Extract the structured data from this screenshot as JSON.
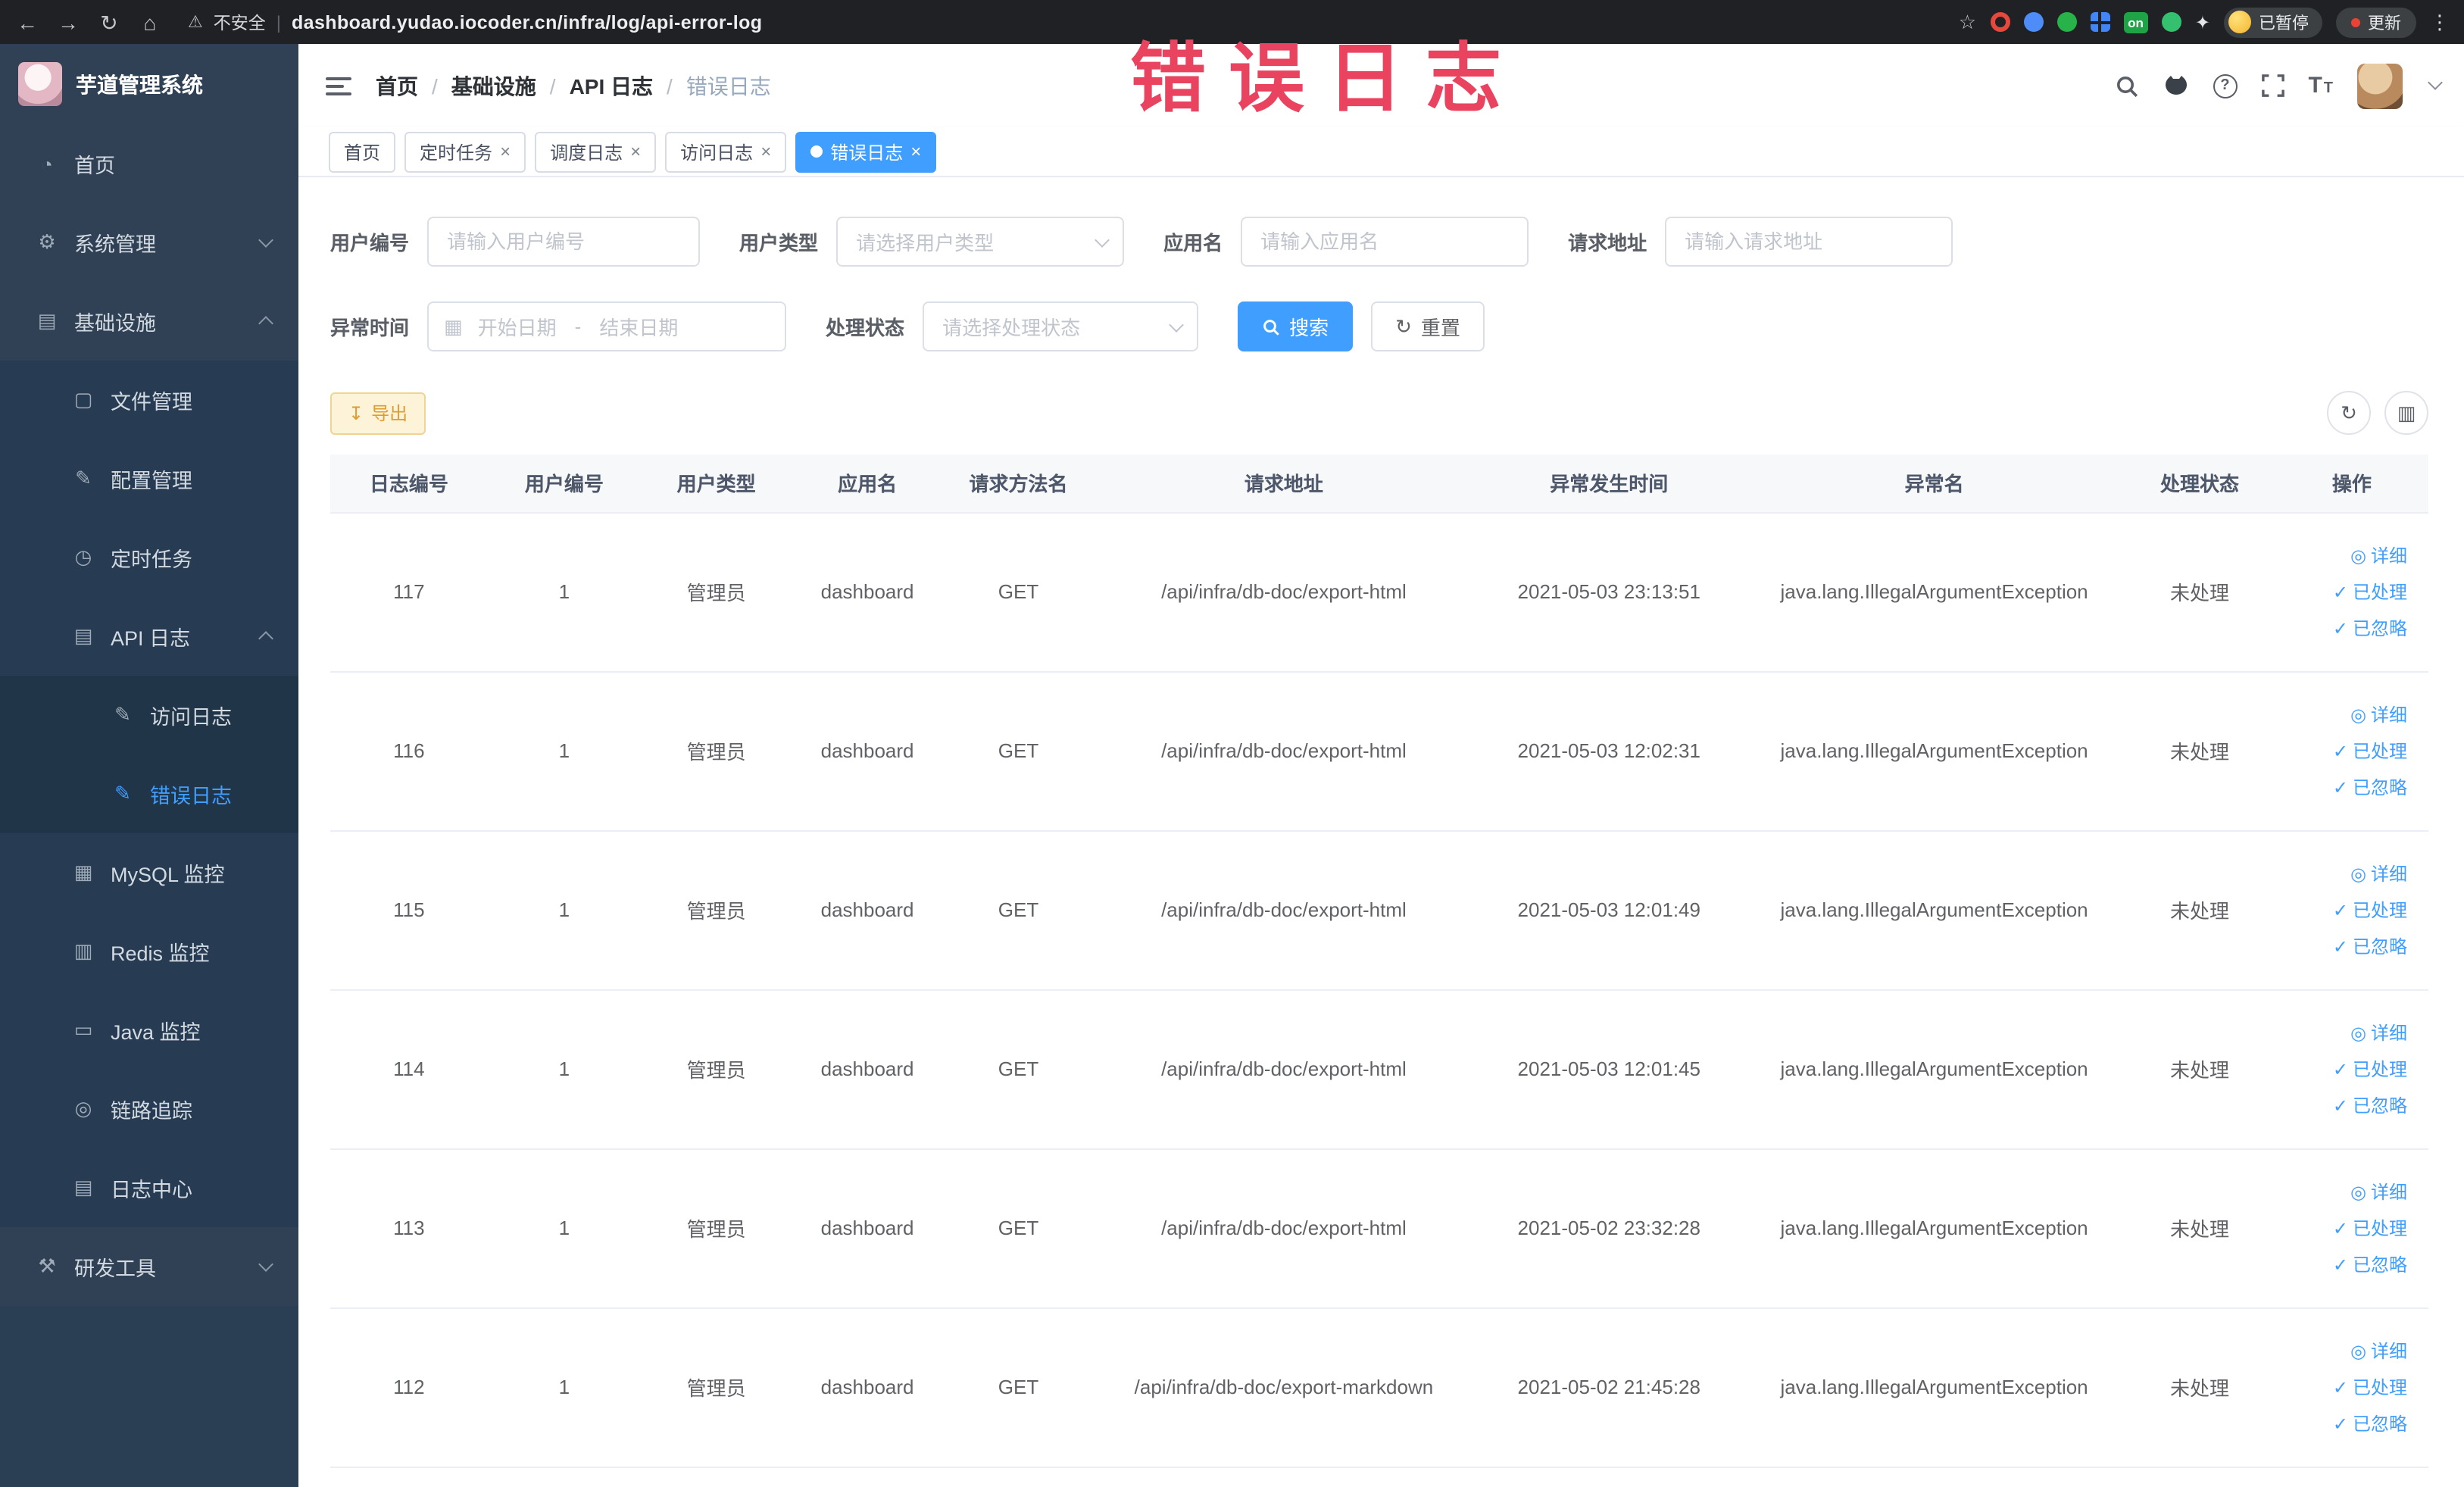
{
  "browser": {
    "security_label": "不安全",
    "url": "dashboard.yudao.iocoder.cn/infra/log/api-error-log",
    "paused_badge": "已暂停",
    "update_button": "更新",
    "ext_on_label": "on"
  },
  "annotation": {
    "text": "错误日志",
    "color": "#e94360"
  },
  "sidebar": {
    "logo_title": "芋道管理系统",
    "items": [
      {
        "label": "首页"
      },
      {
        "label": "系统管理"
      },
      {
        "label": "基础设施"
      },
      {
        "label": "文件管理"
      },
      {
        "label": "配置管理"
      },
      {
        "label": "定时任务"
      },
      {
        "label": "API 日志"
      },
      {
        "label": "访问日志"
      },
      {
        "label": "错误日志"
      },
      {
        "label": "MySQL 监控"
      },
      {
        "label": "Redis 监控"
      },
      {
        "label": "Java 监控"
      },
      {
        "label": "链路追踪"
      },
      {
        "label": "日志中心"
      },
      {
        "label": "研发工具"
      }
    ]
  },
  "breadcrumb": {
    "separator": "/",
    "items": [
      "首页",
      "基础设施",
      "API 日志",
      "错误日志"
    ]
  },
  "tabs": [
    {
      "label": "首页"
    },
    {
      "label": "定时任务"
    },
    {
      "label": "调度日志"
    },
    {
      "label": "访问日志"
    },
    {
      "label": "错误日志"
    }
  ],
  "filters": {
    "user_id": {
      "label": "用户编号",
      "placeholder": "请输入用户编号"
    },
    "user_type": {
      "label": "用户类型",
      "placeholder": "请选择用户类型"
    },
    "app_name": {
      "label": "应用名",
      "placeholder": "请输入应用名"
    },
    "request_url": {
      "label": "请求地址",
      "placeholder": "请输入请求地址"
    },
    "exception_time": {
      "label": "异常时间",
      "start_placeholder": "开始日期",
      "separator": "-",
      "end_placeholder": "结束日期"
    },
    "process_status": {
      "label": "处理状态",
      "placeholder": "请选择处理状态"
    },
    "search_button": "搜索",
    "reset_button": "重置"
  },
  "toolbar": {
    "export_label": "导出"
  },
  "table": {
    "columns": [
      "日志编号",
      "用户编号",
      "用户类型",
      "应用名",
      "请求方法名",
      "请求地址",
      "异常发生时间",
      "异常名",
      "处理状态",
      "操作"
    ],
    "actions": {
      "detail": "详细",
      "processed": "已处理",
      "ignored": "已忽略"
    },
    "rows": [
      {
        "id": "117",
        "user_id": "1",
        "user_type": "管理员",
        "app": "dashboard",
        "method": "GET",
        "url": "/api/infra/db-doc/export-html",
        "time": "2021-05-03 23:13:51",
        "exception": "java.lang.IllegalArgumentException",
        "status": "未处理"
      },
      {
        "id": "116",
        "user_id": "1",
        "user_type": "管理员",
        "app": "dashboard",
        "method": "GET",
        "url": "/api/infra/db-doc/export-html",
        "time": "2021-05-03 12:02:31",
        "exception": "java.lang.IllegalArgumentException",
        "status": "未处理"
      },
      {
        "id": "115",
        "user_id": "1",
        "user_type": "管理员",
        "app": "dashboard",
        "method": "GET",
        "url": "/api/infra/db-doc/export-html",
        "time": "2021-05-03 12:01:49",
        "exception": "java.lang.IllegalArgumentException",
        "status": "未处理"
      },
      {
        "id": "114",
        "user_id": "1",
        "user_type": "管理员",
        "app": "dashboard",
        "method": "GET",
        "url": "/api/infra/db-doc/export-html",
        "time": "2021-05-03 12:01:45",
        "exception": "java.lang.IllegalArgumentException",
        "status": "未处理"
      },
      {
        "id": "113",
        "user_id": "1",
        "user_type": "管理员",
        "app": "dashboard",
        "method": "GET",
        "url": "/api/infra/db-doc/export-html",
        "time": "2021-05-02 23:32:28",
        "exception": "java.lang.IllegalArgumentException",
        "status": "未处理"
      },
      {
        "id": "112",
        "user_id": "1",
        "user_type": "管理员",
        "app": "dashboard",
        "method": "GET",
        "url": "/api/infra/db-doc/export-markdown",
        "time": "2021-05-02 21:45:28",
        "exception": "java.lang.IllegalArgumentException",
        "status": "未处理"
      }
    ]
  },
  "icons": {
    "back": "←",
    "forward": "→",
    "reload": "↻",
    "home": "⌂",
    "warning": "⚠",
    "star": "☆",
    "more_vertical": "⋮",
    "pipe": "|",
    "close": "×",
    "pin": "✦",
    "dashboard": "◔",
    "system": "⚙",
    "infra": "▤",
    "file": "▢",
    "config": "✎",
    "job": "◷",
    "api_log": "▤",
    "log_doc": "✎",
    "mysql": "▦",
    "redis": "▥",
    "java": "▭",
    "trace": "◎",
    "log_center": "▤",
    "tools": "⚒",
    "question": "?",
    "font": "T",
    "export": "↧",
    "refresh": "↻",
    "columns": "▥",
    "calendar": "▦",
    "eye": "◎",
    "check": "✓"
  }
}
